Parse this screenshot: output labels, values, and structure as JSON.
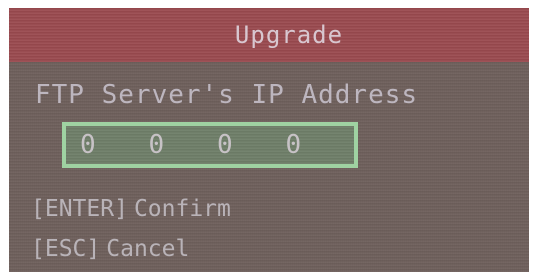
{
  "dialog": {
    "title": "Upgrade",
    "field_label": "FTP Server's IP Address",
    "ip_octets": [
      "0",
      "0",
      "0",
      "0"
    ],
    "hints": [
      {
        "key": "[ENTER]",
        "action": "Confirm"
      },
      {
        "key": "[ESC]",
        "action": "Cancel"
      }
    ]
  },
  "colors": {
    "background": "#6d5e5a",
    "title_bar": "#9a4a4f",
    "ip_box_border": "#9fd2a2",
    "text": "#b9b3b8"
  }
}
